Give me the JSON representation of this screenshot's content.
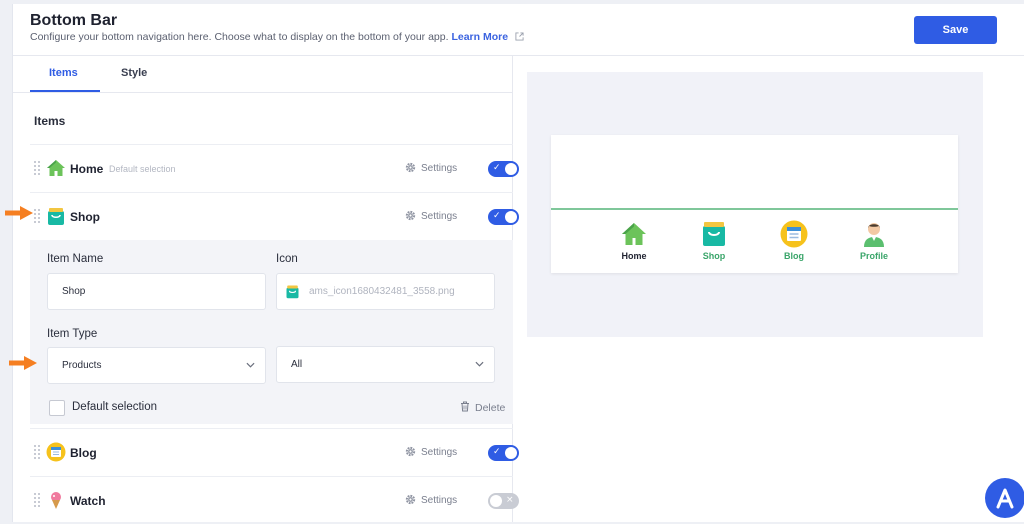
{
  "header": {
    "title": "Bottom Bar",
    "subtitle": "Configure your bottom navigation here. Choose what to display on the bottom of your app.",
    "learn_more": "Learn More",
    "save_label": "Save"
  },
  "tabs": [
    {
      "label": "Items",
      "active": true
    },
    {
      "label": "Style",
      "active": false
    }
  ],
  "section_title": "Items",
  "items": [
    {
      "label": "Home",
      "note": "Default selection",
      "settings": "Settings",
      "enabled": true,
      "icon": "home-icon"
    },
    {
      "label": "Shop",
      "settings": "Settings",
      "enabled": true,
      "icon": "shopping-bag-icon"
    },
    {
      "label": "Blog",
      "settings": "Settings",
      "enabled": true,
      "icon": "blog-icon"
    },
    {
      "label": "Watch",
      "settings": "Settings",
      "enabled": false,
      "icon": "ice-cream-icon"
    }
  ],
  "editor": {
    "item_name_label": "Item Name",
    "item_name_value": "Shop",
    "icon_label": "Icon",
    "icon_value": "ams_icon1680432481_3558.png",
    "item_type_label": "Item Type",
    "item_type_value": "Products",
    "filter_value": "All",
    "default_selection_label": "Default selection",
    "delete_label": "Delete"
  },
  "preview": {
    "nav": [
      {
        "label": "Home",
        "color": "#1f2230"
      },
      {
        "label": "Shop",
        "color": "#3aa56a"
      },
      {
        "label": "Blog",
        "color": "#3aa56a"
      },
      {
        "label": "Profile",
        "color": "#3aa56a"
      }
    ]
  },
  "colors": {
    "accent": "#2f5ce4",
    "highlight_arrow": "#f57f22",
    "nav_active_line": "#7fc79a"
  }
}
